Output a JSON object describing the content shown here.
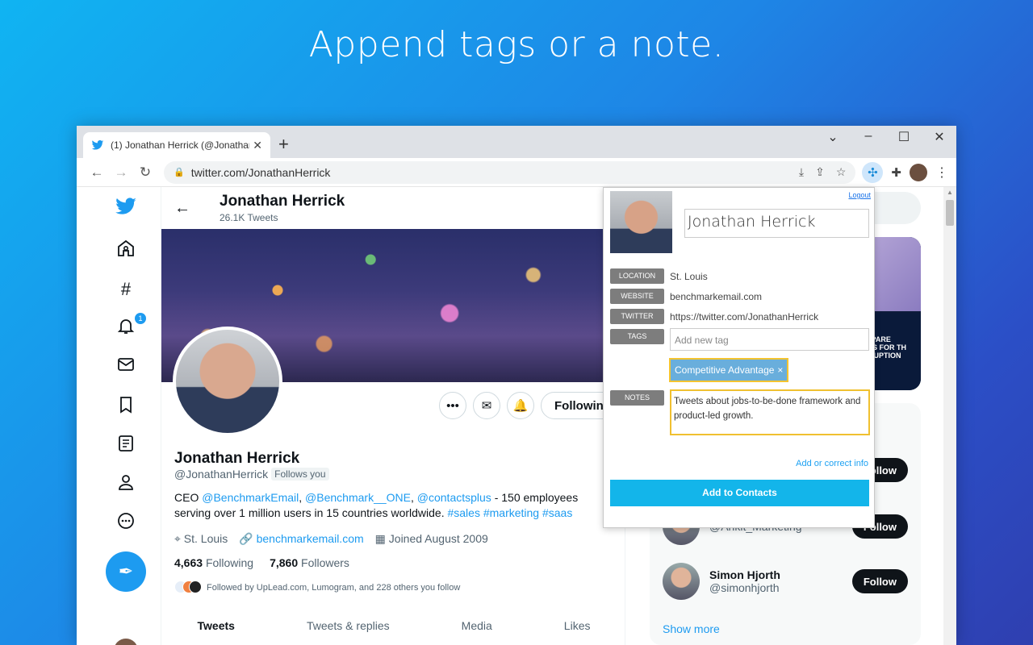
{
  "headline": "Append tags or a note.",
  "browser": {
    "tab_title": "(1) Jonathan Herrick (@Jonathan",
    "url": "twitter.com/JonathanHerrick"
  },
  "twitter": {
    "notification_count": "1",
    "header": {
      "name": "Jonathan Herrick",
      "tweet_count": "26.1K Tweets"
    },
    "profile": {
      "name": "Jonathan Herrick",
      "handle": "@JonathanHerrick",
      "follows_you": "Follows you",
      "bio_prefix": "CEO ",
      "bio_link1": "@BenchmarkEmail",
      "bio_sep1": ", ",
      "bio_link2": "@Benchmark__ONE",
      "bio_sep2": ", ",
      "bio_link3": "@contactsplus",
      "bio_mid": " - 150 employees serving over 1 million users in 15 countries worldwide. ",
      "bio_tags": "#sales #marketing #saas",
      "location": "St. Louis",
      "website": "benchmarkemail.com",
      "joined": "Joined August 2009",
      "following_count": "4,663",
      "following_label": "Following",
      "followers_count": "7,860",
      "followers_label": "Followers",
      "followed_by": "Followed by UpLead.com, Lumogram, and 228 others you follow",
      "following_button": "Following"
    },
    "tabs": [
      "Tweets",
      "Tweets & replies",
      "Media",
      "Likes"
    ],
    "who_to_follow": [
      {
        "name": "",
        "handle": "",
        "button": "Follow"
      },
      {
        "name": "",
        "handle": "@Ankit_Marketing",
        "button": "Follow"
      },
      {
        "name": "Simon Hjorth",
        "handle": "@simonhjorth",
        "button": "Follow"
      }
    ],
    "show_more": "Show more",
    "media_text": "PREPARE\nEAMS FOR TH\nDISRUPTION"
  },
  "popup": {
    "logout": "Logout",
    "name": "Jonathan Herrick",
    "labels": {
      "location": "LOCATION",
      "website": "WEBSITE",
      "twitter": "TWITTER",
      "tags": "TAGS",
      "notes": "NOTES"
    },
    "location": "St. Louis",
    "website": "benchmarkemail.com",
    "twitter": "https://twitter.com/JonathanHerrick",
    "tag_placeholder": "Add new tag",
    "tag": "Competitive Advantage",
    "notes": "Tweets about jobs-to-be-done framework and product-led growth.",
    "add_correct": "Add or correct info",
    "add_button": "Add to Contacts"
  },
  "colors": {
    "twitter_blue": "#1d9bf0",
    "contacts_button": "#13b5ea",
    "highlight": "#f0c030"
  }
}
